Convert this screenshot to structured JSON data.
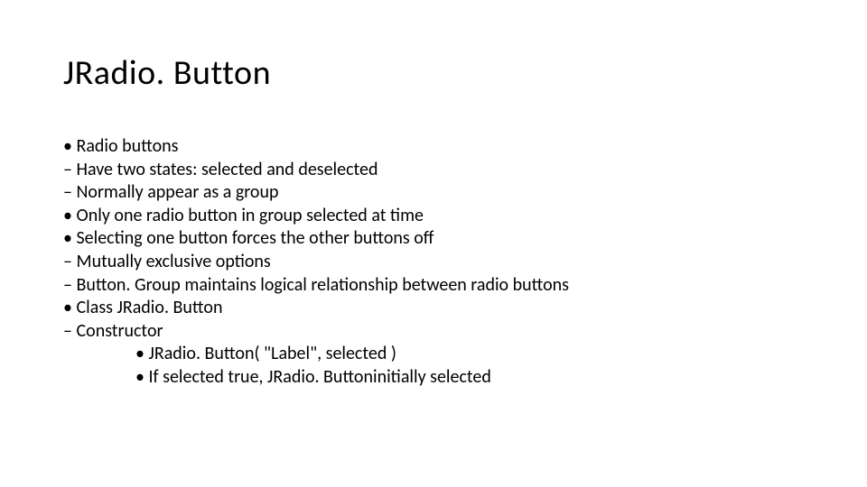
{
  "title": "JRadio. Button",
  "lines": [
    {
      "text": "• Radio buttons",
      "indent": false
    },
    {
      "text": "– Have two states: selected and deselected",
      "indent": false
    },
    {
      "text": "– Normally appear as a group",
      "indent": false
    },
    {
      "text": "• Only one radio button in group selected at time",
      "indent": false
    },
    {
      "text": "• Selecting one button forces the other buttons off",
      "indent": false
    },
    {
      "text": "– Mutually exclusive options",
      "indent": false
    },
    {
      "text": "– Button. Group maintains logical relationship between radio buttons",
      "indent": false
    },
    {
      "text": "• Class JRadio. Button",
      "indent": false
    },
    {
      "text": "– Constructor",
      "indent": false
    },
    {
      "text": "• JRadio. Button( \"Label\", selected )",
      "indent": true
    },
    {
      "text": "• If selected  true, JRadio. Buttoninitially selected",
      "indent": true
    }
  ]
}
